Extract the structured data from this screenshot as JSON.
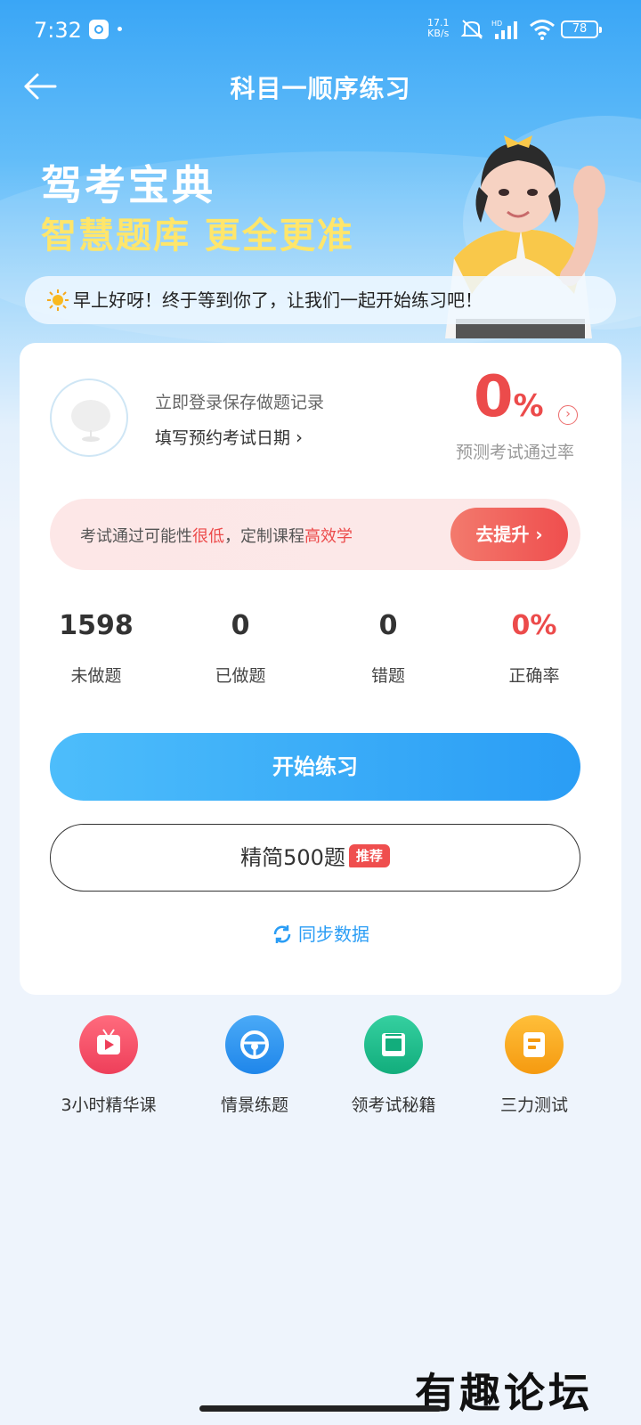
{
  "status_bar": {
    "time": "7:32",
    "speed_value": "17.1",
    "speed_unit": "KB/s",
    "network": "HD",
    "battery": "78"
  },
  "nav": {
    "back_icon": "arrow-left-icon",
    "title": "科目一顺序练习"
  },
  "banner": {
    "title": "驾考宝典",
    "subtitle": "智慧题库 更全更准",
    "greeting": "早上好呀！终于等到你了，让我们一起开始练习吧！"
  },
  "profile": {
    "login_tip": "立即登录保存做题记录",
    "exam_date_link": "填写预约考试日期",
    "pass_rate_value": "0",
    "pass_rate_unit": "%",
    "pass_rate_label": "预测考试通过率"
  },
  "promo": {
    "text_prefix": "考试通过可能性",
    "text_low": "很低",
    "text_middle": "，定制课程",
    "text_efficient": "高效学",
    "button_label": "去提升 ›"
  },
  "stats": [
    {
      "value": "1598",
      "label": "未做题"
    },
    {
      "value": "0",
      "label": "已做题"
    },
    {
      "value": "0",
      "label": "错题"
    },
    {
      "value": "0%",
      "label": "正确率"
    }
  ],
  "actions": {
    "start_label": "开始练习",
    "simple_label": "精简500题",
    "recommend_badge": "推荐",
    "sync_label": "同步数据"
  },
  "tools": [
    {
      "label": "3小时精华课",
      "icon": "video-icon",
      "color": "#f0506a"
    },
    {
      "label": "情景练题",
      "icon": "steering-wheel-icon",
      "color": "#2f95f2"
    },
    {
      "label": "领考试秘籍",
      "icon": "book-icon",
      "color": "#1fbf8f"
    },
    {
      "label": "三力测试",
      "icon": "document-icon",
      "color": "#f8a623"
    }
  ],
  "watermark": "有趣论坛",
  "colors": {
    "primary": "#2a9df5",
    "danger": "#ec4b4b",
    "banner_yellow": "#ffe66b"
  }
}
